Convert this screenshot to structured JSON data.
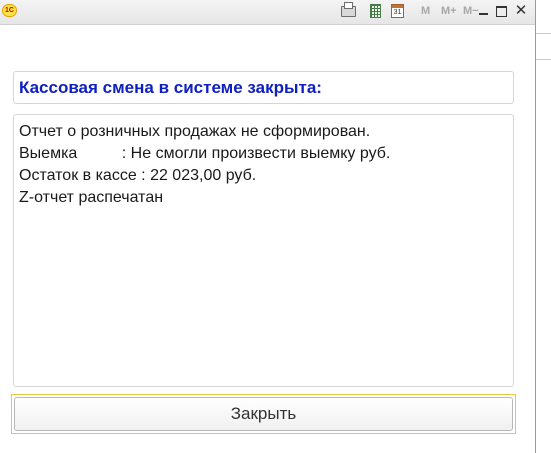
{
  "titlebar": {
    "app_logo_text": "1С",
    "icons": [
      "printer-icon",
      "calculator-icon",
      "calendar-icon"
    ],
    "calendar_day": "31",
    "memory_buttons": [
      "M",
      "M+",
      "M−"
    ],
    "window_controls": [
      "minimize-icon",
      "maximize-icon",
      "close-icon"
    ],
    "close_glyph": "✕"
  },
  "header": {
    "text": "Кассовая смена в системе закрыта:",
    "color": "#1020c0"
  },
  "message": {
    "lines": [
      "Отчет о розничных продажах не сформирован.",
      "Выемка          : Не смогли произвести выемку руб.",
      "Остаток в кассе : 22 023,00 руб.",
      "Z-отчет распечатан"
    ]
  },
  "footer": {
    "close_label": "Закрыть",
    "focus_color": "#e8c840"
  }
}
